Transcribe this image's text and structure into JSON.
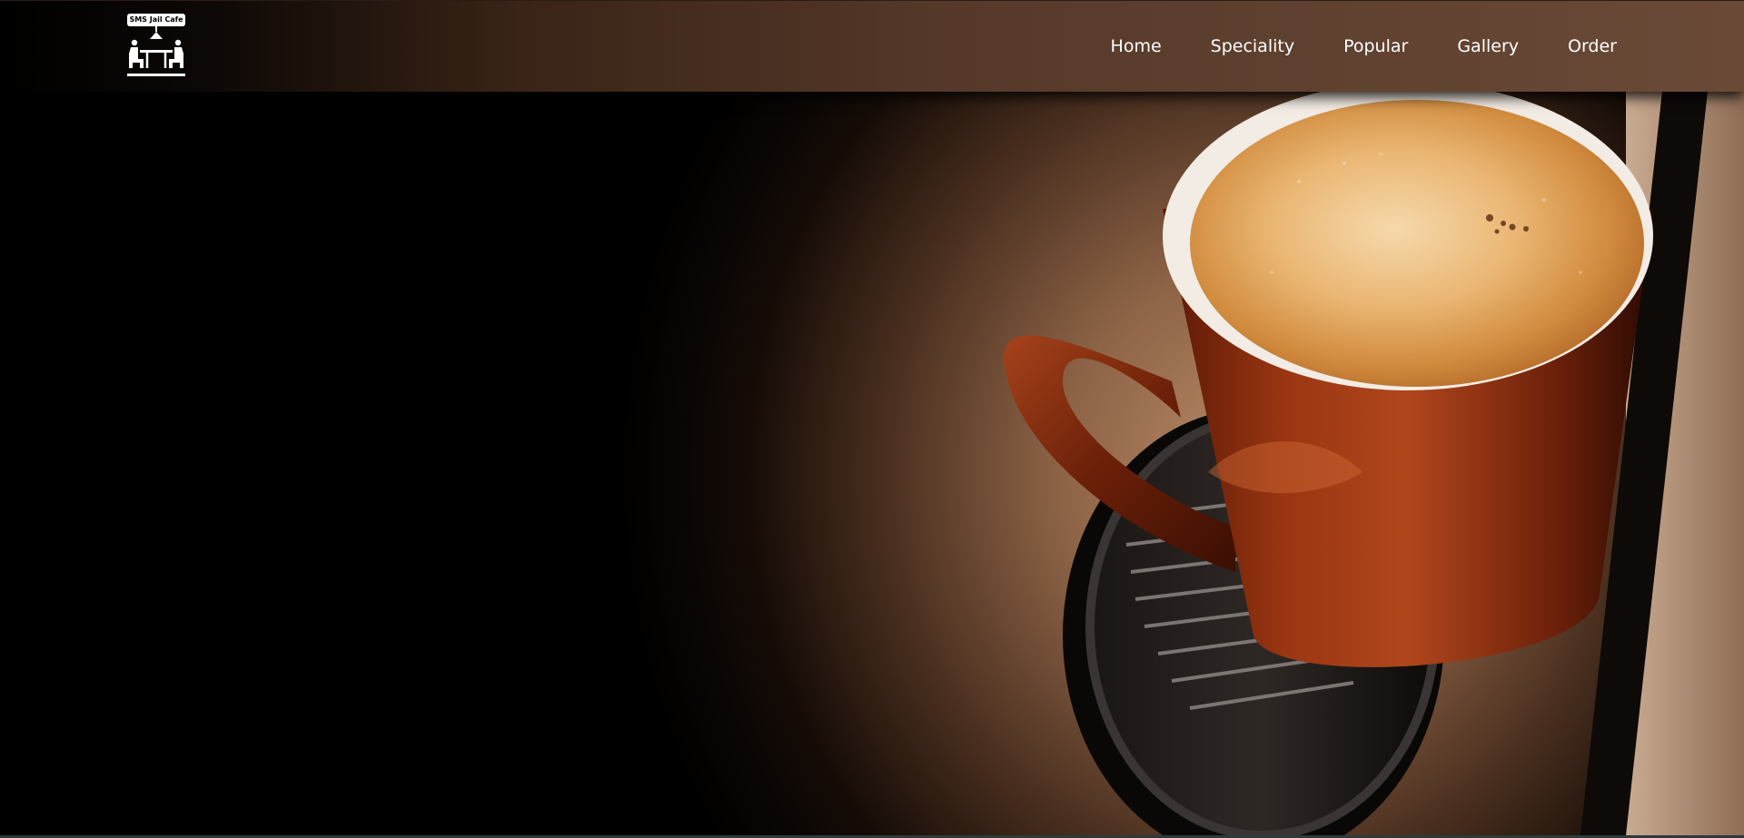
{
  "brand": {
    "logo_text": "SMS Jail Cafe"
  },
  "nav": {
    "items": [
      {
        "label": "Home"
      },
      {
        "label": "Speciality"
      },
      {
        "label": "Popular"
      },
      {
        "label": "Gallery"
      },
      {
        "label": "Order"
      }
    ]
  },
  "hero": {
    "image": "coffee-cup-on-espresso-machine"
  },
  "colors": {
    "nav_text": "#ffffff",
    "header_dark": "#000000",
    "header_light": "#6a4a37",
    "cup": "#8a2a0f",
    "crema": "#e0a867"
  }
}
